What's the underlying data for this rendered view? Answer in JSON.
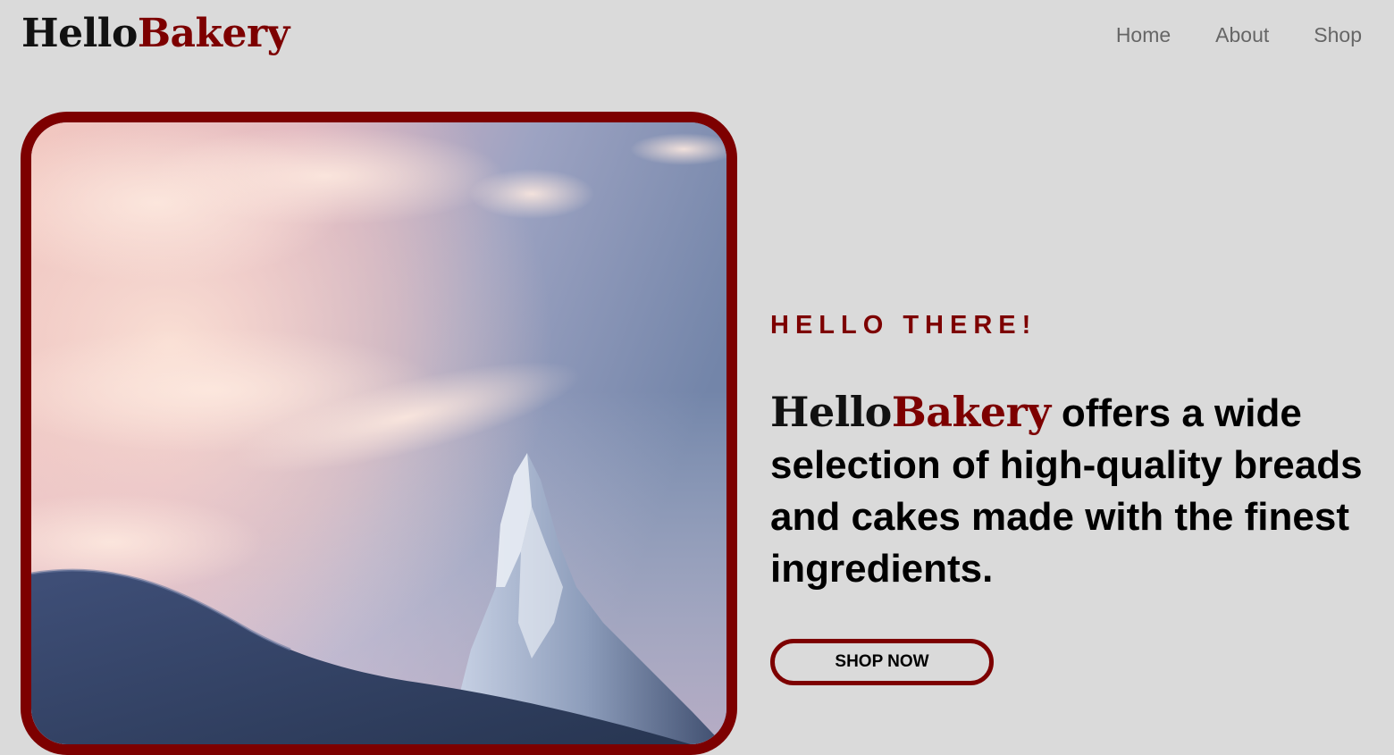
{
  "header": {
    "logo": {
      "hello": "Hello",
      "bakery": "Bakery"
    },
    "nav": [
      {
        "label": "Home"
      },
      {
        "label": "About"
      },
      {
        "label": "Shop"
      }
    ]
  },
  "hero": {
    "image_description": "snow-capped mountain peak under pink sunset clouds",
    "eyebrow": "HELLO THERE!",
    "headline": {
      "brand_hello": "Hello",
      "brand_bakery": "Bakery",
      "text": "offers a wide selection of high-quality breads and cakes made with the finest ingredients."
    },
    "cta_label": "SHOP NOW"
  },
  "colors": {
    "background": "#dadada",
    "brand_red": "#7d0000",
    "nav_text": "#666666",
    "headline_text": "#000000"
  }
}
